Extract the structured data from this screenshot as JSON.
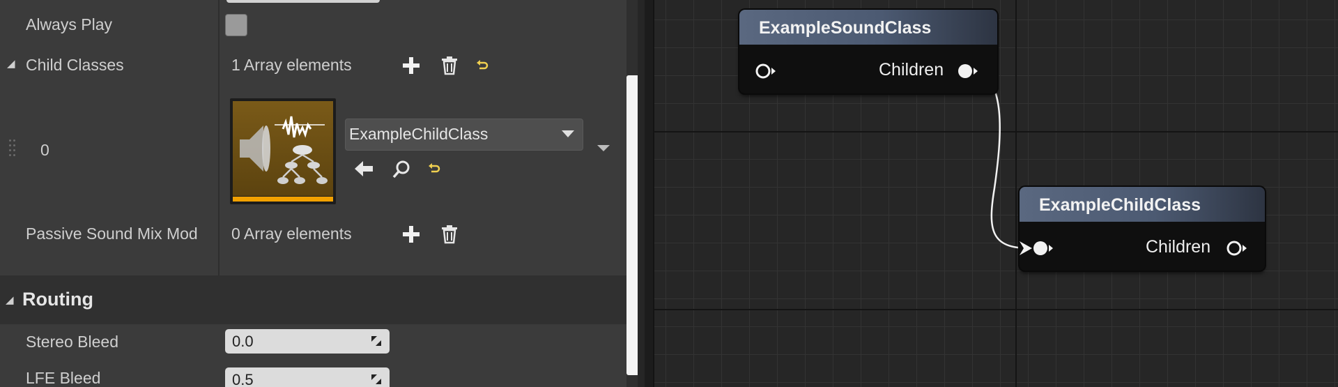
{
  "details": {
    "always_play": {
      "label": "Always Play",
      "checked": false
    },
    "child_classes": {
      "label": "Child Classes",
      "count_text": "1 Array elements",
      "items": [
        {
          "index": "0",
          "asset_name": "ExampleChildClass"
        }
      ]
    },
    "passive_sound_mix": {
      "label": "Passive Sound Mix Mod",
      "count_text": "0 Array elements"
    },
    "routing": {
      "title": "Routing",
      "stereo_bleed": {
        "label": "Stereo Bleed",
        "value": "0.0"
      },
      "lfe_bleed": {
        "label": "LFE Bleed",
        "value": "0.5"
      }
    }
  },
  "graph": {
    "nodes": [
      {
        "title": "ExampleSoundClass",
        "output_pin": "Children"
      },
      {
        "title": "ExampleChildClass",
        "output_pin": "Children"
      }
    ]
  },
  "colors": {
    "panel_bg": "#3b3b3b",
    "graph_bg": "#262626",
    "node_header": "#5a6880",
    "thumbnail_accent": "#f2a100"
  },
  "icons": [
    "plus-icon",
    "trash-icon",
    "reset-arrow-icon",
    "browse-arrow-icon",
    "search-icon",
    "sound-class-icon",
    "spin-icon"
  ]
}
